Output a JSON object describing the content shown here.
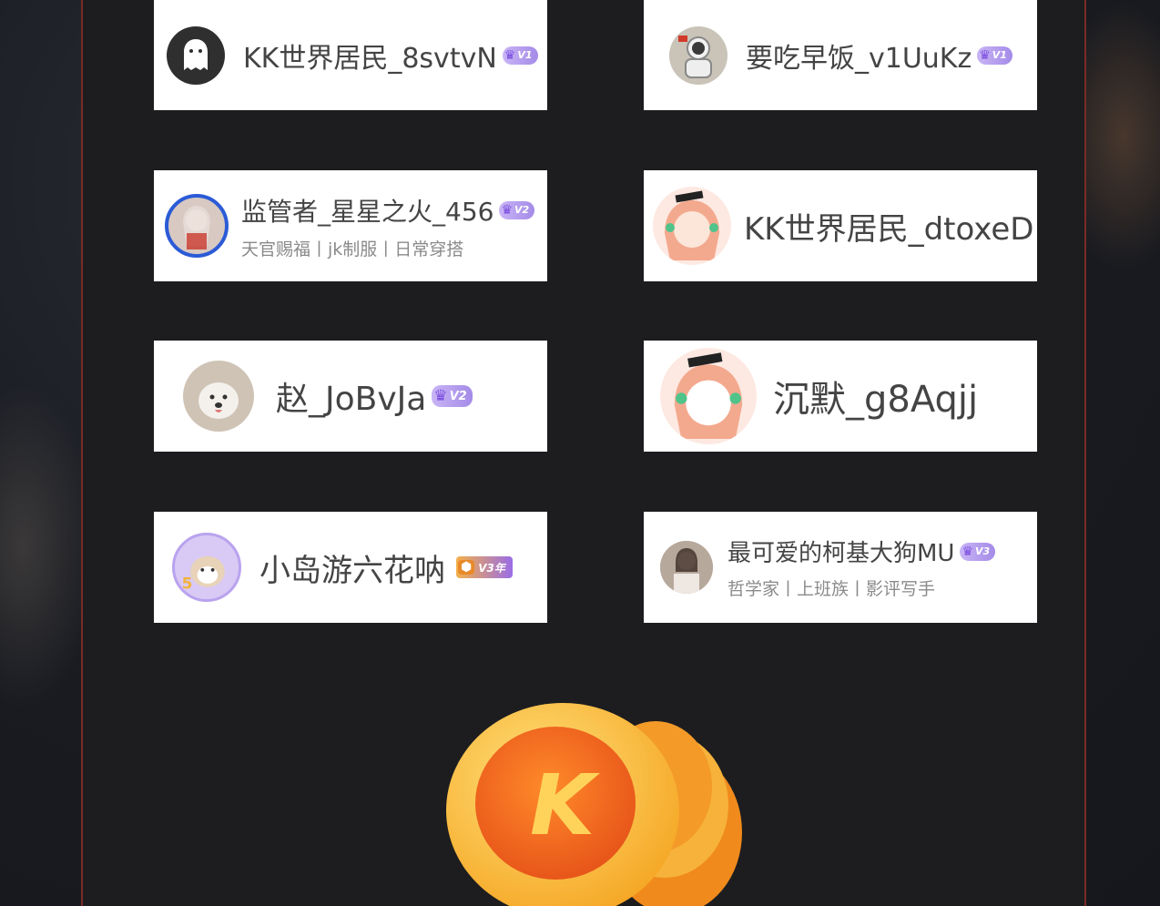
{
  "users": [
    {
      "name": "KK世界居民_8svtvN",
      "badge": "V1",
      "subtitle": "",
      "avatar_icon": "ghost-icon",
      "avatar_color": "#2f2f2f"
    },
    {
      "name": "要吃早饭_v1UuKz",
      "badge": "V1",
      "subtitle": "",
      "avatar_icon": "astronaut-icon",
      "avatar_color": "#c9c3b8"
    },
    {
      "name": "监管者_星星之火_456",
      "badge": "V2",
      "subtitle": "天官赐福丨jk制服丨日常穿搭",
      "avatar_icon": "anime-girl-icon",
      "avatar_color": "#d8c9c2"
    },
    {
      "name": "KK世界居民_dtoxeD",
      "badge": "",
      "subtitle": "",
      "avatar_icon": "anime-girl-icon",
      "avatar_color": "#f3a98e"
    },
    {
      "name": "赵_JoBvJa",
      "badge": "V2",
      "subtitle": "",
      "avatar_icon": "dog-icon",
      "avatar_color": "#cfc3b5"
    },
    {
      "name": "沉默_g8Aqjj",
      "badge": "",
      "subtitle": "",
      "avatar_icon": "anime-girl-icon",
      "avatar_color": "#f3a98e"
    },
    {
      "name": "小岛游六花呐",
      "badge": "V3年",
      "subtitle": "",
      "avatar_icon": "dog-icon",
      "avatar_color": "#d9c9f5"
    },
    {
      "name": "最可爱的柯基大狗MU",
      "badge": "V3",
      "subtitle": "哲学家丨上班族丨影评写手",
      "avatar_icon": "portrait-icon",
      "avatar_color": "#c6b8b0"
    }
  ],
  "coin": {
    "letter": "K"
  },
  "colors": {
    "card_bg": "#ffffff",
    "panel_bg": "#1d1d1f",
    "panel_border": "#7a2a26",
    "badge_purple": "#a48be8",
    "coin_orange": "#f08a1c"
  }
}
